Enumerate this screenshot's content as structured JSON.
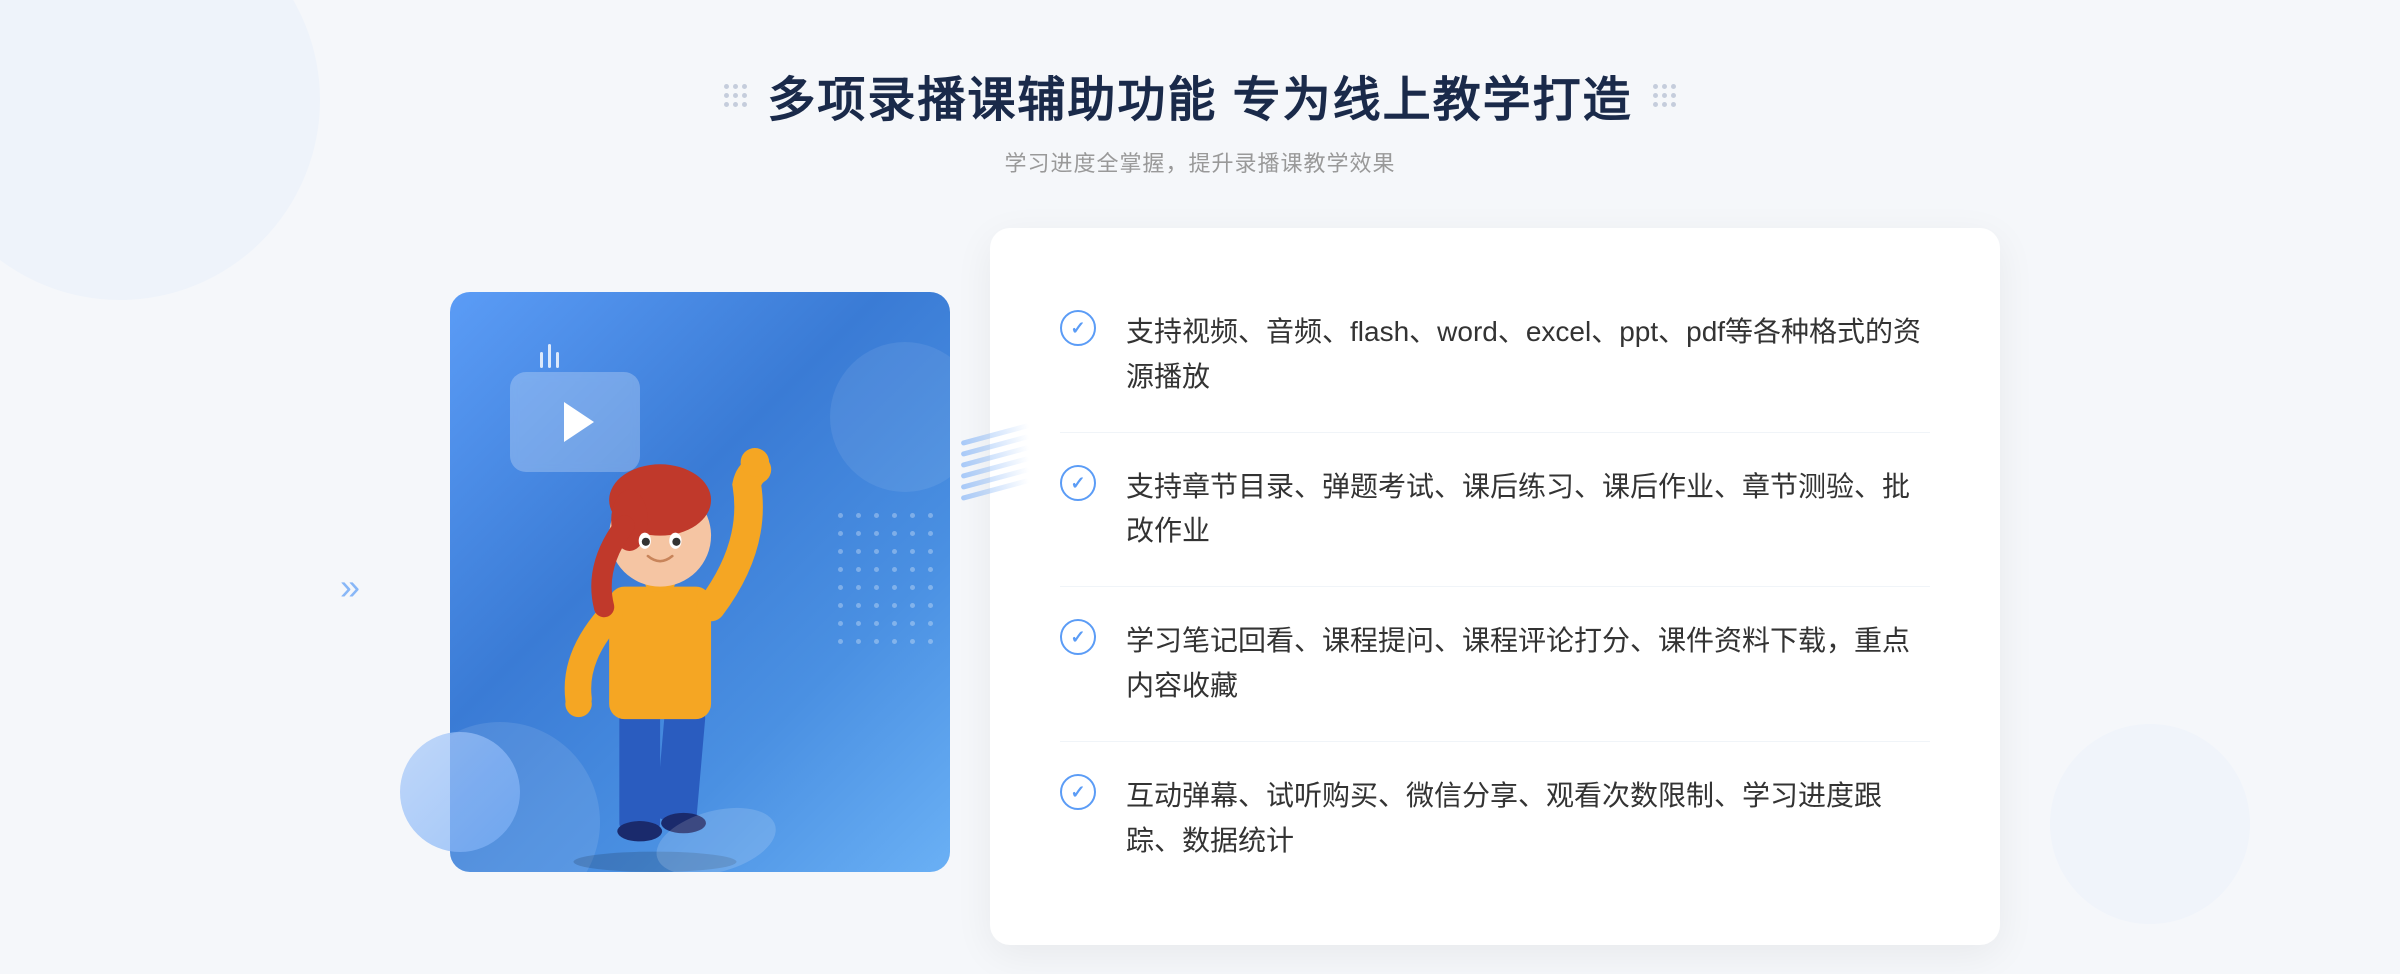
{
  "header": {
    "title": "多项录播课辅助功能 专为线上教学打造",
    "subtitle": "学习进度全掌握，提升录播课教学效果"
  },
  "features": [
    {
      "id": 1,
      "text": "支持视频、音频、flash、word、excel、ppt、pdf等各种格式的资源播放"
    },
    {
      "id": 2,
      "text": "支持章节目录、弹题考试、课后练习、课后作业、章节测验、批改作业"
    },
    {
      "id": 3,
      "text": "学习笔记回看、课程提问、课程评论打分、课件资料下载，重点内容收藏"
    },
    {
      "id": 4,
      "text": "互动弹幕、试听购买、微信分享、观看次数限制、学习进度跟踪、数据统计"
    }
  ],
  "decorations": {
    "left_arrow": "»",
    "title_decoration_left": "⠿",
    "title_decoration_right": "⠿"
  }
}
